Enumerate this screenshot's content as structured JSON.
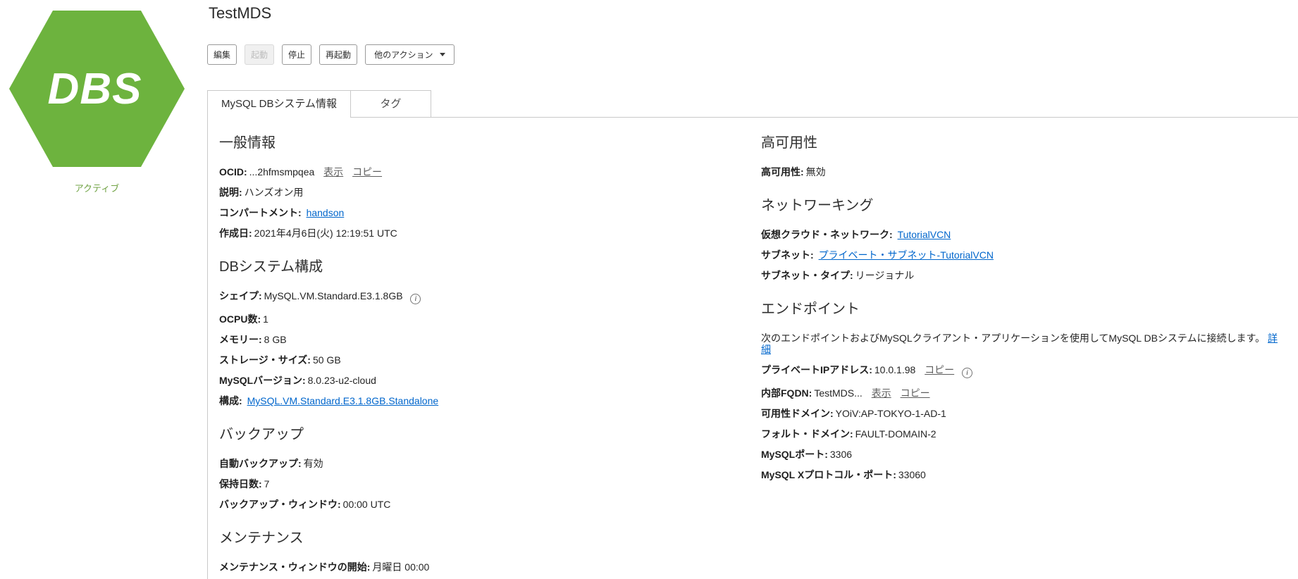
{
  "colors": {
    "icon_green": "#6db33e",
    "status_green": "#71a345",
    "link_blue": "#0066cc"
  },
  "icon": {
    "label": "DBS",
    "status": "アクティブ"
  },
  "header": {
    "title": "TestMDS"
  },
  "toolbar": {
    "edit": "編集",
    "start": "起動",
    "stop": "停止",
    "restart": "再起動",
    "more_actions": "他のアクション"
  },
  "tabs": {
    "info": "MySQL DBシステム情報",
    "tags": "タグ"
  },
  "icons": {
    "info": "i"
  },
  "left": {
    "general": {
      "heading": "一般情報",
      "ocid": {
        "label": "OCID:",
        "value": "...2hfmsmpqea",
        "show": "表示",
        "copy": "コピー"
      },
      "description": {
        "label": "説明:",
        "value": "ハンズオン用"
      },
      "compartment": {
        "label": "コンパートメント:",
        "link": "handson"
      },
      "created": {
        "label": "作成日:",
        "value": "2021年4月6日(火) 12:19:51 UTC"
      }
    },
    "config": {
      "heading": "DBシステム構成",
      "shape": {
        "label": "シェイプ:",
        "value": "MySQL.VM.Standard.E3.1.8GB"
      },
      "ocpu": {
        "label": "OCPU数:",
        "value": "1"
      },
      "memory": {
        "label": "メモリー:",
        "value": "8 GB"
      },
      "storage": {
        "label": "ストレージ・サイズ:",
        "value": "50 GB"
      },
      "version": {
        "label": "MySQLバージョン:",
        "value": "8.0.23-u2-cloud"
      },
      "configuration": {
        "label": "構成:",
        "link": "MySQL.VM.Standard.E3.1.8GB.Standalone"
      }
    },
    "backup": {
      "heading": "バックアップ",
      "auto": {
        "label": "自動バックアップ:",
        "value": "有効"
      },
      "retention": {
        "label": "保持日数:",
        "value": "7"
      },
      "window": {
        "label": "バックアップ・ウィンドウ:",
        "value": "00:00 UTC"
      }
    },
    "maintenance": {
      "heading": "メンテナンス",
      "window_start": {
        "label": "メンテナンス・ウィンドウの開始:",
        "value": "月曜日 00:00"
      }
    }
  },
  "right": {
    "ha": {
      "heading": "高可用性",
      "enabled": {
        "label": "高可用性:",
        "value": "無効"
      }
    },
    "networking": {
      "heading": "ネットワーキング",
      "vcn": {
        "label": "仮想クラウド・ネットワーク:",
        "link": "TutorialVCN"
      },
      "subnet": {
        "label": "サブネット:",
        "link": "プライベート・サブネット-TutorialVCN"
      },
      "subnet_type": {
        "label": "サブネット・タイプ:",
        "value": "リージョナル"
      }
    },
    "endpoints": {
      "heading": "エンドポイント",
      "description": "次のエンドポイントおよびMySQLクライアント・アプリケーションを使用してMySQL DBシステムに接続します。",
      "details_link": "詳細",
      "private_ip": {
        "label": "プライベートIPアドレス:",
        "value": "10.0.1.98",
        "copy": "コピー"
      },
      "fqdn": {
        "label": "内部FQDN:",
        "value": "TestMDS...",
        "show": "表示",
        "copy": "コピー"
      },
      "ad": {
        "label": "可用性ドメイン:",
        "value": "YOiV:AP-TOKYO-1-AD-1"
      },
      "fd": {
        "label": "フォルト・ドメイン:",
        "value": "FAULT-DOMAIN-2"
      },
      "port": {
        "label": "MySQLポート:",
        "value": "3306"
      },
      "xport": {
        "label": "MySQL Xプロトコル・ポート:",
        "value": "33060"
      }
    }
  }
}
